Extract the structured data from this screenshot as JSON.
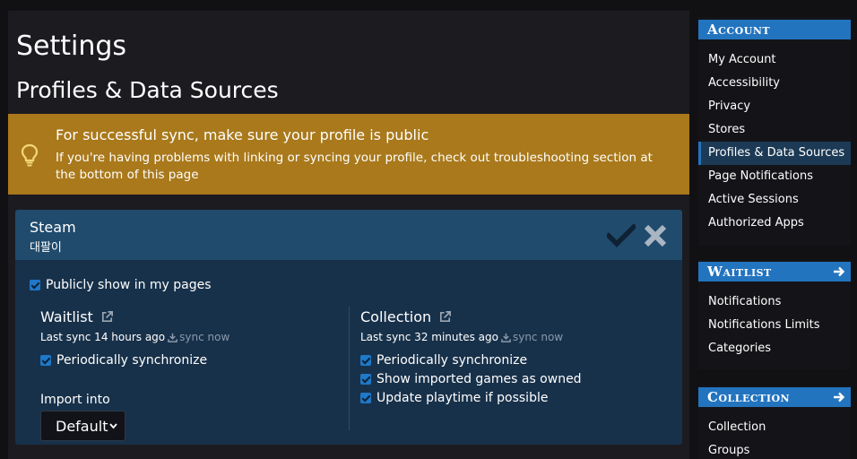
{
  "page": {
    "title": "Settings",
    "subtitle": "Profiles & Data Sources"
  },
  "banner": {
    "title": "For successful sync, make sure your profile is public",
    "text": "If you're having problems with linking or syncing your profile, check out troubleshooting section at the bottom of this page",
    "icon": "lightbulb-icon",
    "color": "#a9791b"
  },
  "card": {
    "title": "Steam",
    "username": "대팔이",
    "public_label": "Publicly show in my pages",
    "waitlist": {
      "title": "Waitlist",
      "last_sync": "Last sync 14 hours ago",
      "sync_now": "sync now",
      "periodic_label": "Periodically synchronize",
      "import_label": "Import into",
      "import_value": "Default"
    },
    "collection": {
      "title": "Collection",
      "last_sync": "Last sync 32 minutes ago",
      "sync_now": "sync now",
      "periodic_label": "Periodically synchronize",
      "owned_label": "Show imported games as owned",
      "playtime_label": "Update playtime if possible"
    }
  },
  "sidebar": {
    "account": {
      "heading": "Account",
      "items": [
        "My Account",
        "Accessibility",
        "Privacy",
        "Stores",
        "Profiles & Data Sources",
        "Page Notifications",
        "Active Sessions",
        "Authorized Apps"
      ],
      "active": "Profiles & Data Sources"
    },
    "waitlist": {
      "heading": "Waitlist",
      "items": [
        "Notifications",
        "Notifications Limits",
        "Categories"
      ]
    },
    "collection": {
      "heading": "Collection",
      "items": [
        "Collection",
        "Groups"
      ]
    }
  },
  "colors": {
    "accent": "#2374bf",
    "card_header": "#204b6d",
    "card_body": "#18314a"
  }
}
